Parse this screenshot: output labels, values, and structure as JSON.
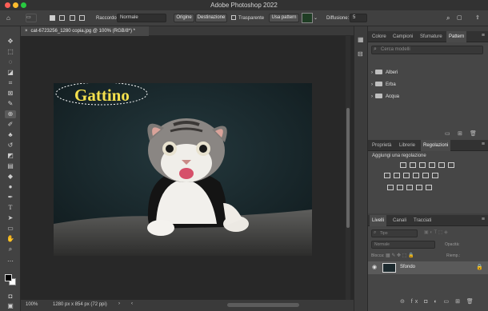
{
  "window": {
    "title": "Adobe Photoshop 2022"
  },
  "options_bar": {
    "feather_label": "Raccordo:",
    "mode_select": "Normale",
    "origin_button": "Origine",
    "destination_button": "Destinazione",
    "transparent_label": "Trasparente",
    "use_pattern_button": "Usa pattern",
    "diffusion_label": "Diffusione:",
    "diffusion_value": "5"
  },
  "document": {
    "tab_title": "cat-6723256_1280 copia.jpg @ 100% (RGB/8*) *",
    "text_layer_content": "Gattino"
  },
  "status_bar": {
    "zoom": "100%",
    "dimensions": "1280 px x 854 px (72 ppi)"
  },
  "panel_pattern": {
    "tabs": [
      "Colore",
      "Campioni",
      "Sfumature",
      "Pattern"
    ],
    "active_tab": "Pattern",
    "search_placeholder": "Cerca modelli",
    "folders": [
      "Alberi",
      "Erba",
      "Acqua"
    ]
  },
  "panel_adjust": {
    "tabs": [
      "Proprietà",
      "Librerie",
      "Regolazioni"
    ],
    "active_tab": "Regolazioni",
    "heading": "Aggiungi una regolazione"
  },
  "panel_layers": {
    "tabs": [
      "Livelli",
      "Canali",
      "Tracciati"
    ],
    "active_tab": "Livelli",
    "filter_kind": "Tipo",
    "blend_mode": "Normale",
    "opacity_label": "Opacità:",
    "lock_label": "Blocca:",
    "fill_label": "Riemp.:",
    "layers": [
      {
        "name": "Sfondo"
      }
    ]
  },
  "colors": {
    "accent": "#2d76d8",
    "selection_text": "#f4e04d"
  }
}
